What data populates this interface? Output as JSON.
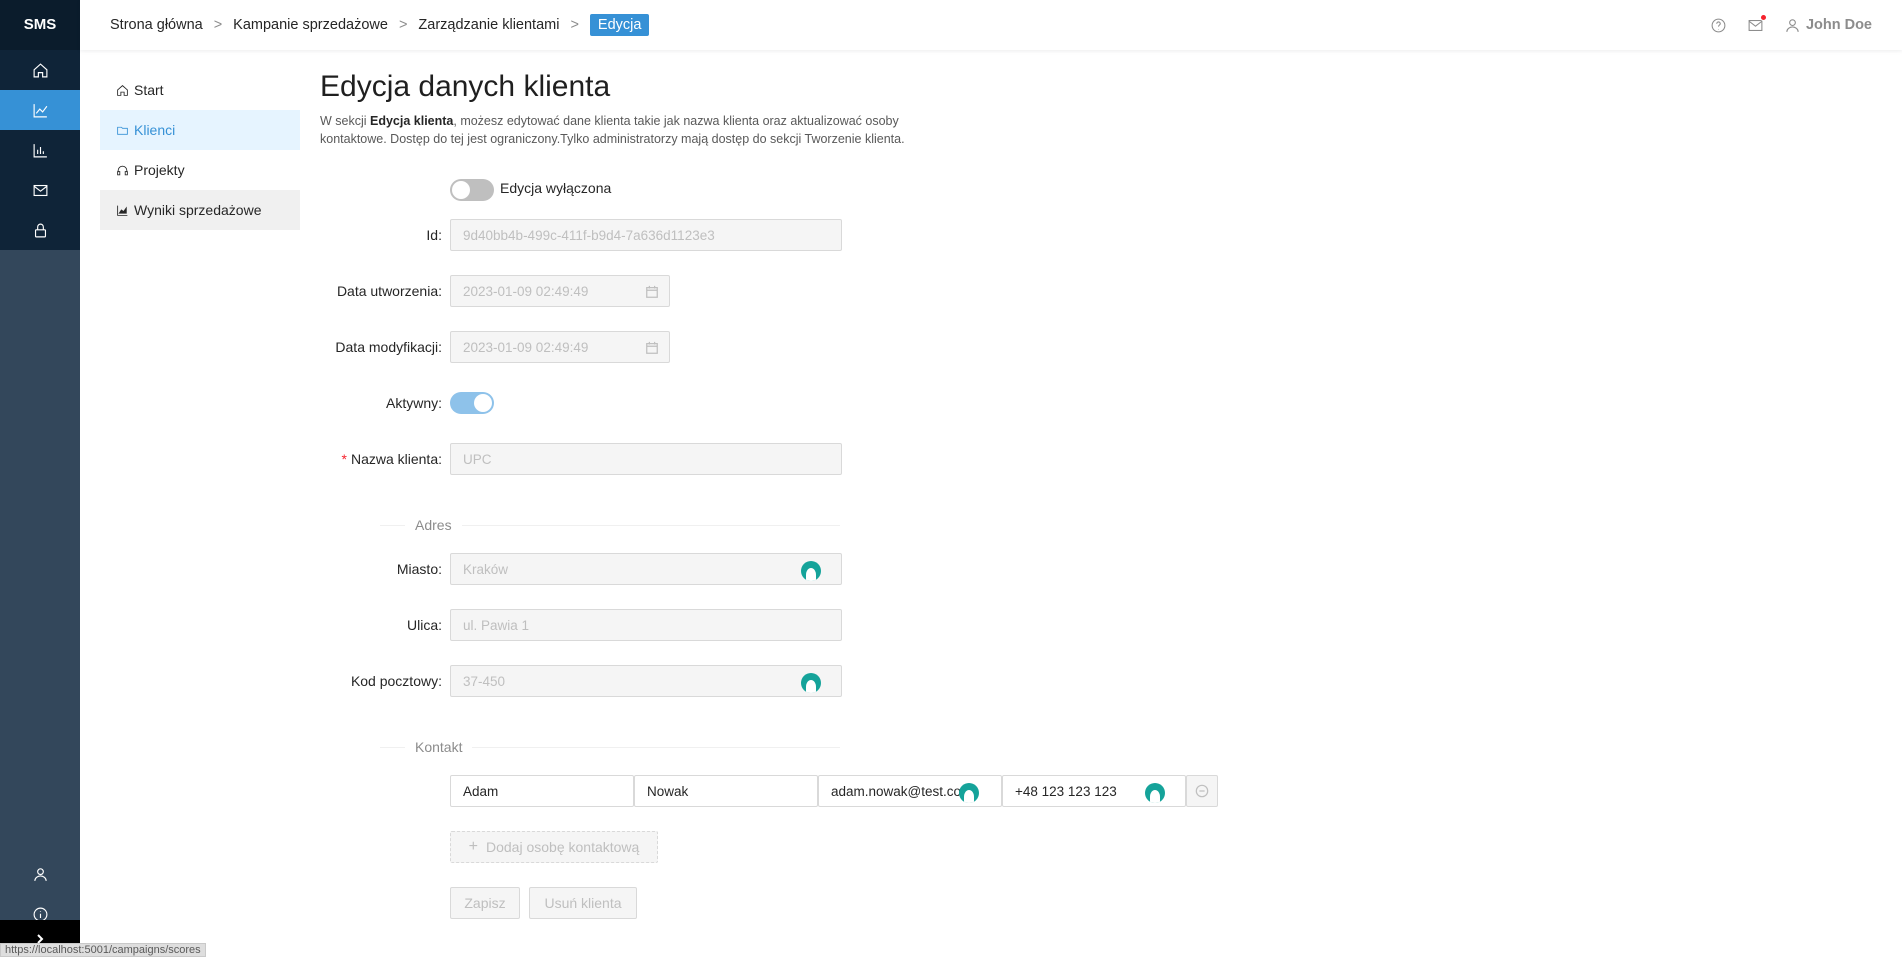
{
  "app": {
    "logo": "SMS"
  },
  "breadcrumb": {
    "items": [
      "Strona główna",
      "Kampanie sprzedażowe",
      "Zarządzanie klientami"
    ],
    "separator": ">",
    "current": "Edycja"
  },
  "header": {
    "user_name": "John Doe",
    "notification_dot_color": "#f5222d"
  },
  "rail": {
    "icons": [
      "home-icon",
      "line-chart-icon",
      "bar-chart-icon",
      "mail-icon",
      "lock-icon"
    ],
    "active_index": 1,
    "bottom_icons": [
      "user-icon",
      "info-icon"
    ],
    "collapse_icon": "chevron-right-icon"
  },
  "submenu": {
    "items": [
      {
        "label": "Start",
        "icon": "home-icon"
      },
      {
        "label": "Klienci",
        "icon": "folder-icon"
      },
      {
        "label": "Projekty",
        "icon": "headset-icon"
      },
      {
        "label": "Wyniki sprzedażowe",
        "icon": "area-chart-icon"
      }
    ],
    "active_index": 1
  },
  "page": {
    "title": "Edycja danych klienta",
    "desc_prefix": "W sekcji ",
    "desc_bold": "Edycja klienta",
    "desc_suffix": ", możesz edytować dane klienta takie jak nazwa klienta oraz aktualizować osoby kontaktowe. Dostęp do tej jest ograniczony.Tylko administratorzy mają dostęp do sekcji Tworzenie klienta."
  },
  "form": {
    "edit_toggle": {
      "label": "Edycja wyłączona",
      "checked": false
    },
    "id": {
      "label": "Id",
      "value": "9d40bb4b-499c-411f-b9d4-7a636d1123e3"
    },
    "created": {
      "label": "Data utworzenia",
      "value": "2023-01-09 02:49:49"
    },
    "modified": {
      "label": "Data modyfikacji",
      "value": "2023-01-09 02:49:49"
    },
    "active": {
      "label": "Aktywny",
      "checked": true
    },
    "client_name": {
      "label": "Nazwa klienta",
      "value": "UPC",
      "required": true
    },
    "address_section": "Adres",
    "city": {
      "label": "Miasto",
      "value": "Kraków"
    },
    "street": {
      "label": "Ulica",
      "value": "ul. Pawia 1"
    },
    "zip": {
      "label": "Kod pocztowy",
      "value": "37-450"
    },
    "contact_section": "Kontakt",
    "contact": {
      "first_name": "Adam",
      "last_name": "Nowak",
      "email": "adam.nowak@test.com",
      "phone": "+48 123 123 123"
    },
    "add_contact_label": "Dodaj osobę kontaktową",
    "save_label": "Zapisz",
    "delete_label": "Usuń klienta"
  },
  "statusbar": {
    "url": "https://localhost:5001/campaigns/scores"
  },
  "colors": {
    "primary": "#3691d6",
    "rail_dark": "#0f2438",
    "rail": "#33475b",
    "grammarly": "#15a39a"
  }
}
